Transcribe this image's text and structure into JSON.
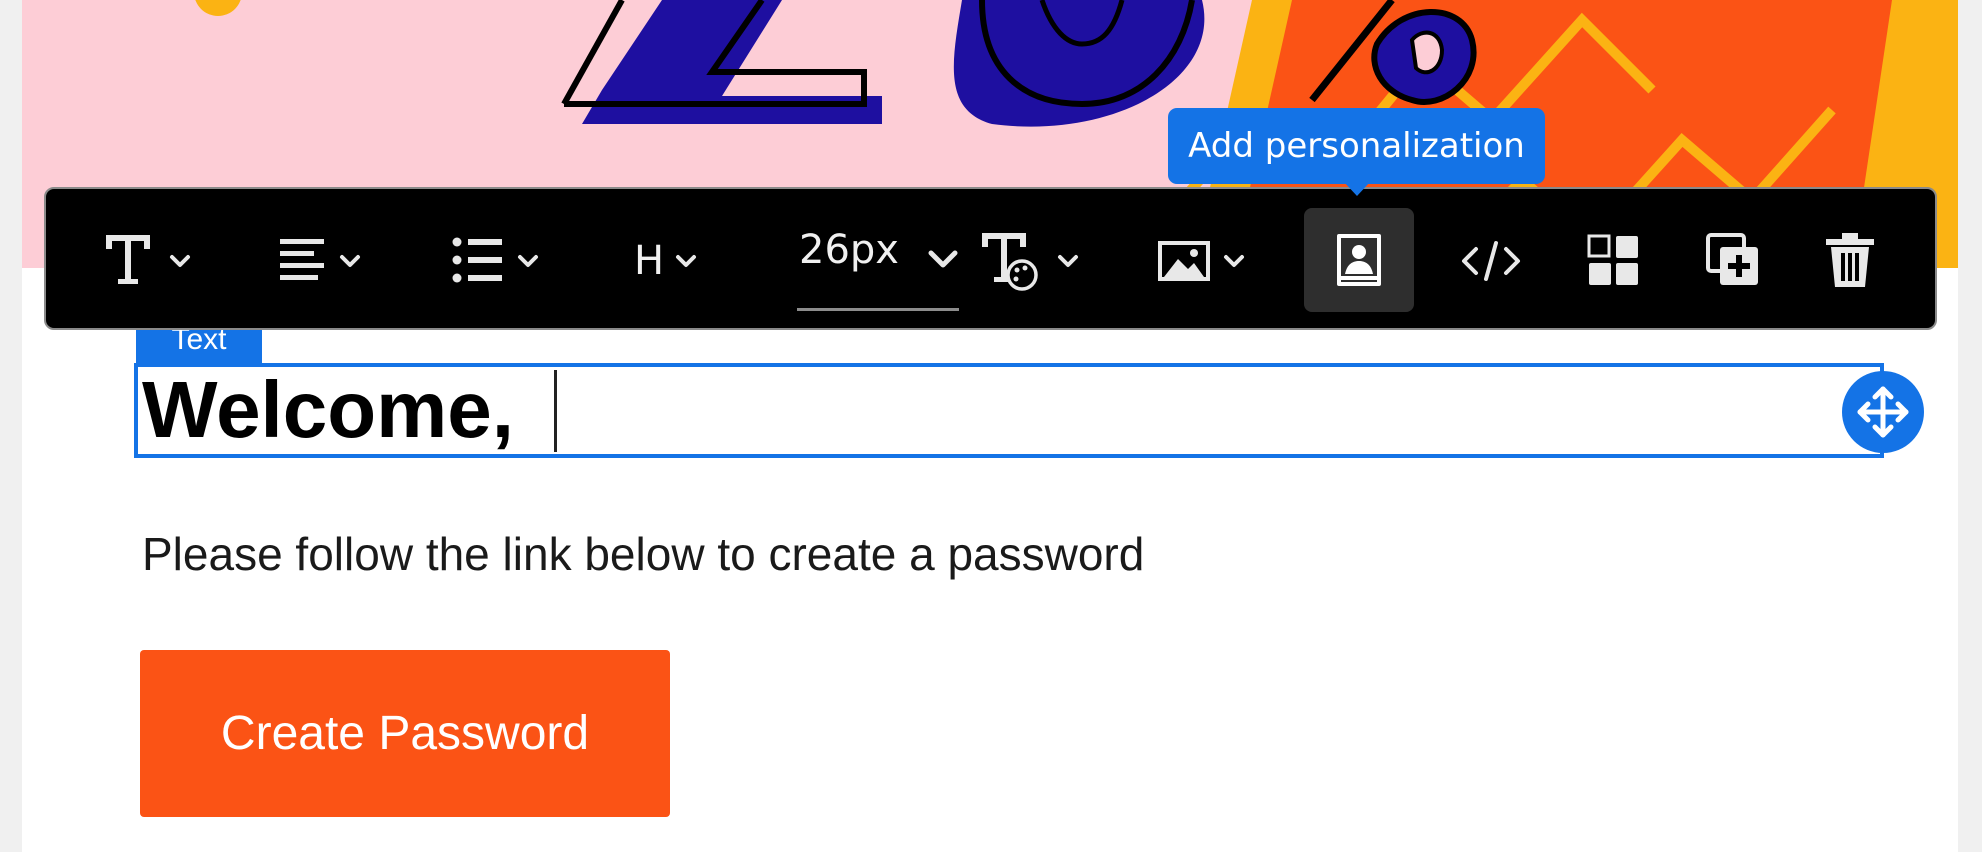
{
  "hero": {
    "colors": {
      "background": "#fdcdd6",
      "navy": "#1e0fa0",
      "orange": "#fb5315",
      "yellow": "#fbb313"
    }
  },
  "toolbar": {
    "items": [
      {
        "name": "text-format",
        "icon": "text-format-icon"
      },
      {
        "name": "align",
        "icon": "align-left-icon"
      },
      {
        "name": "list",
        "icon": "bulleted-list-icon"
      },
      {
        "name": "heading",
        "icon": "heading-icon",
        "label": "H"
      },
      {
        "name": "font-size",
        "value": "26px"
      },
      {
        "name": "text-style",
        "icon": "text-style-palette-icon"
      },
      {
        "name": "image",
        "icon": "image-icon"
      },
      {
        "name": "personalization",
        "icon": "personalization-icon",
        "active": true
      },
      {
        "name": "html",
        "icon": "code-icon"
      },
      {
        "name": "layout",
        "icon": "layout-grid-icon"
      },
      {
        "name": "duplicate",
        "icon": "duplicate-icon"
      },
      {
        "name": "delete",
        "icon": "trash-icon"
      }
    ],
    "tooltip": "Add personalization"
  },
  "selected_component": {
    "tag": "Text",
    "heading": "Welcome,"
  },
  "body": {
    "paragraph": "Please follow the link below to create a password",
    "cta_label": "Create Password"
  },
  "colors": {
    "accent": "#1473e6",
    "button": "#fb5315",
    "toolbar": "#000000"
  }
}
